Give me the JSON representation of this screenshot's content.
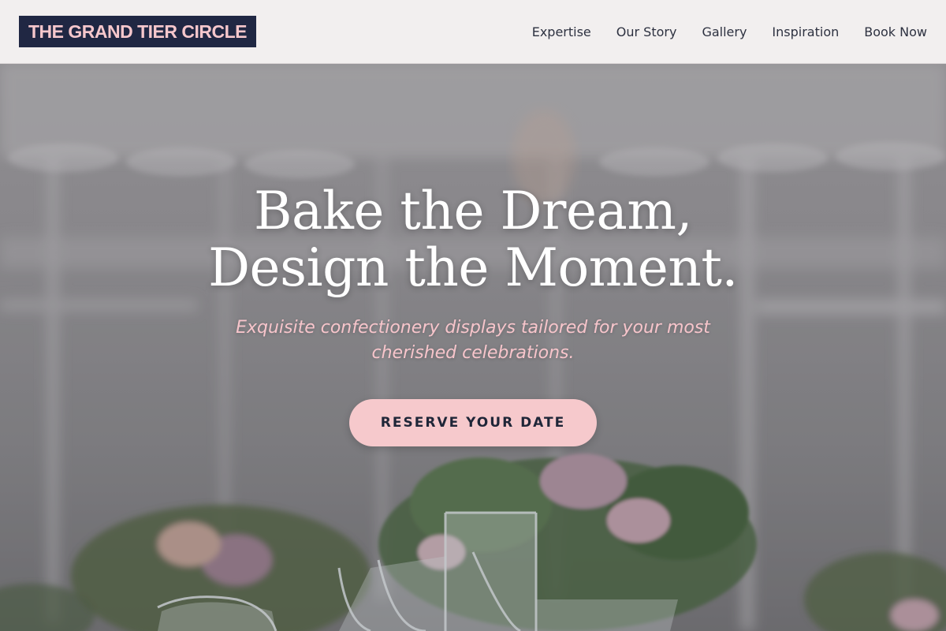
{
  "brand": {
    "logo_text": "THE GRAND TIER CIRCLE"
  },
  "nav": {
    "items": [
      {
        "label": "Expertise"
      },
      {
        "label": "Our Story"
      },
      {
        "label": "Gallery"
      },
      {
        "label": "Inspiration"
      },
      {
        "label": "Book Now"
      }
    ]
  },
  "hero": {
    "headline_line1": "Bake the Dream,",
    "headline_line2": "Design the Moment.",
    "tagline": "Exquisite confectionery displays tailored for your most cherished celebrations.",
    "cta_label": "RESERVE YOUR DATE"
  },
  "colors": {
    "brand_navy": "#202743",
    "accent_pink": "#f6c9cc",
    "header_bg": "#f6f2f2"
  }
}
